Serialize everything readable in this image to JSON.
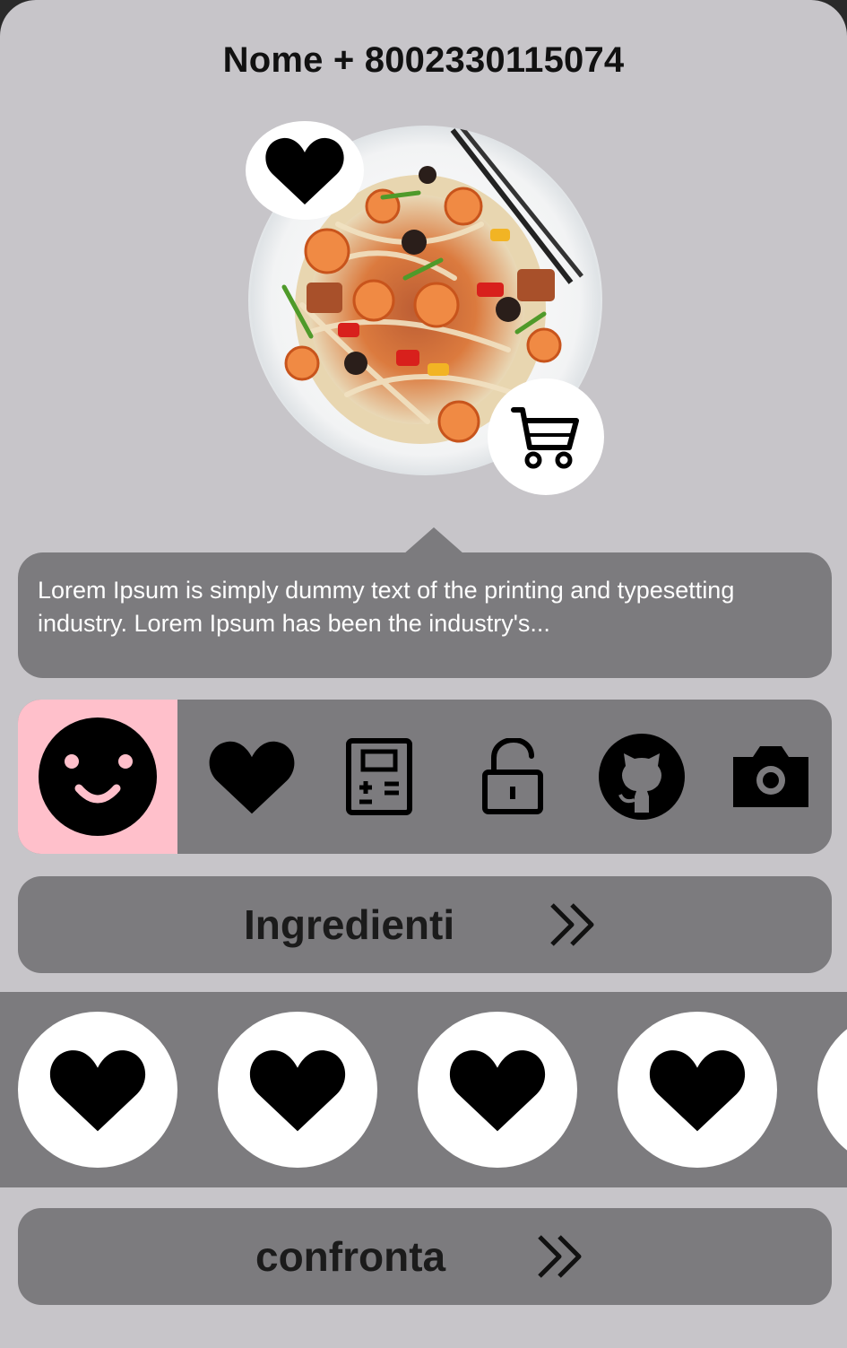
{
  "product": {
    "title": "Nome + 8002330115074",
    "image_alt": "noodle dish with shrimp and vegetables",
    "favorite_icon": "heart-icon",
    "cart_icon": "cart-icon"
  },
  "description": {
    "text": "Lorem Ipsum is simply dummy text of the printing and typesetting industry. Lorem Ipsum has been the industry's..."
  },
  "icon_bar": {
    "selected_index": 0,
    "selected_color": "#ffc0cb",
    "items": [
      "smiley-icon",
      "heart-icon",
      "calculator-icon",
      "unlock-icon",
      "github-icon",
      "camera-icon"
    ]
  },
  "ingredients_button": {
    "label": "Ingredienti",
    "icon": "double-chevron-right-icon"
  },
  "favorites_row": {
    "items": [
      "heart-icon",
      "heart-icon",
      "heart-icon",
      "heart-icon",
      "heart-icon"
    ]
  },
  "compare_button": {
    "label": "confronta",
    "icon": "double-chevron-right-icon"
  },
  "colors": {
    "sheet": "#c7c5c9",
    "panel": "#7c7b7e",
    "accent": "#ffc0cb"
  }
}
